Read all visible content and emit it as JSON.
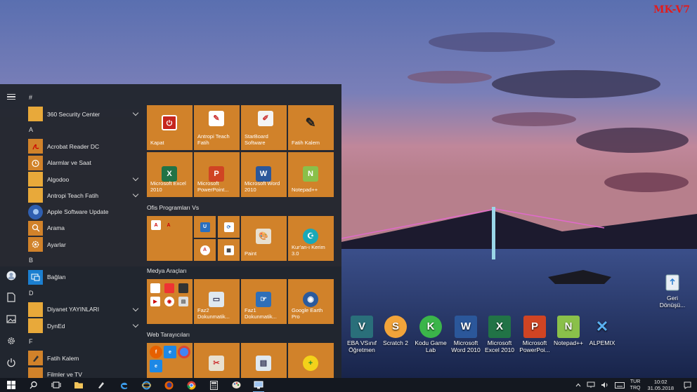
{
  "watermark": "MK-V7",
  "start_menu": {
    "groups": [
      {
        "letter": "#",
        "items": [
          {
            "label": "360 Security Center",
            "icon": "folder-icon",
            "color": "#e8a93a",
            "expandable": true
          }
        ]
      },
      {
        "letter": "A",
        "items": [
          {
            "label": "Acrobat Reader DC",
            "icon": "acrobat-icon",
            "color": "#d1822a",
            "expandable": false
          },
          {
            "label": "Alarmlar ve Saat",
            "icon": "alarm-clock-icon",
            "color": "#d1822a",
            "expandable": false
          },
          {
            "label": "Algodoo",
            "icon": "folder-icon",
            "color": "#e8a93a",
            "expandable": true
          },
          {
            "label": "Antropi Teach Fatih",
            "icon": "folder-icon",
            "color": "#e8a93a",
            "expandable": true
          },
          {
            "label": "Apple Software Update",
            "icon": "apple-update-icon",
            "color": "#2f5fb0",
            "expandable": false
          },
          {
            "label": "Arama",
            "icon": "search-icon",
            "color": "#d1822a",
            "expandable": false
          },
          {
            "label": "Ayarlar",
            "icon": "gear-icon",
            "color": "#d1822a",
            "expandable": false
          }
        ]
      },
      {
        "letter": "B",
        "items": [
          {
            "label": "Bağlan",
            "icon": "connect-icon",
            "color": "#1b7fd0",
            "expandable": false
          }
        ]
      },
      {
        "letter": "D",
        "items": [
          {
            "label": "Diyanet YAYINLARI",
            "icon": "folder-icon",
            "color": "#e8a93a",
            "expandable": true
          },
          {
            "label": "DynEd",
            "icon": "folder-icon",
            "color": "#e8a93a",
            "expandable": true
          }
        ]
      },
      {
        "letter": "F",
        "items": [
          {
            "label": "Fatih Kalem",
            "icon": "pen-icon",
            "color": "#d1822a",
            "expandable": false
          },
          {
            "label": "Filmler ve TV",
            "icon": "film-icon",
            "color": "#d1822a",
            "expandable": false
          }
        ]
      }
    ],
    "tiles_top": [
      {
        "label": "Kapat",
        "icon": "power-icon"
      },
      {
        "label": "Antropi Teach Fatih",
        "icon": "antropi-icon"
      },
      {
        "label": "StarBoard Software",
        "icon": "starboard-icon"
      },
      {
        "label": "Fatih Kalem",
        "icon": "pen-icon"
      },
      {
        "label": "Microsoft Excel 2010",
        "icon": "excel-icon"
      },
      {
        "label": "Microsoft PowerPoint...",
        "icon": "powerpoint-icon"
      },
      {
        "label": "Microsoft Word 2010",
        "icon": "word-icon"
      },
      {
        "label": "Notepad++",
        "icon": "notepadpp-icon"
      }
    ],
    "group_office": {
      "title": "Ofis Programları Vs",
      "tiles": [
        {
          "label": "Paint",
          "icon": "paint-icon"
        },
        {
          "label": "Kur'an-ı Kerim 3.0",
          "icon": "quran-icon"
        }
      ]
    },
    "group_media": {
      "title": "Medya Araçları",
      "tiles": [
        {
          "label": "Faz2 Dokunmatik...",
          "icon": "monitor-icon"
        },
        {
          "label": "Faz1 Dokunmatik...",
          "icon": "touch-board-icon"
        },
        {
          "label": "Google Earth Pro",
          "icon": "google-earth-icon"
        }
      ]
    },
    "group_web": {
      "title": "Web Tarayıcıları"
    }
  },
  "desktop_icons": [
    {
      "label": "Geri Dönüşü...",
      "icon": "recycle-bin-icon"
    },
    {
      "label": "EBA VSınıf Öğretmen",
      "icon": "eba-icon"
    },
    {
      "label": "Scratch 2",
      "icon": "scratch-icon"
    },
    {
      "label": "Kodu Game Lab",
      "icon": "kodu-icon"
    },
    {
      "label": "Microsoft Word 2010",
      "icon": "word-icon"
    },
    {
      "label": "Microsoft Excel 2010",
      "icon": "excel-icon"
    },
    {
      "label": "Microsoft PowerPoi...",
      "icon": "powerpoint-icon"
    },
    {
      "label": "Notepad++",
      "icon": "notepadpp-icon"
    },
    {
      "label": "ALPEMIX",
      "icon": "alpemix-icon"
    }
  ],
  "taskbar": {
    "lang_top": "TUR",
    "lang_bottom": "TRQ",
    "time": "10:02",
    "date": "31.05.2018"
  },
  "colors": {
    "tile": "#d1822a",
    "start_bg": "#22262e",
    "taskbar_bg": "#141820",
    "accent": "#7bb6f0"
  }
}
